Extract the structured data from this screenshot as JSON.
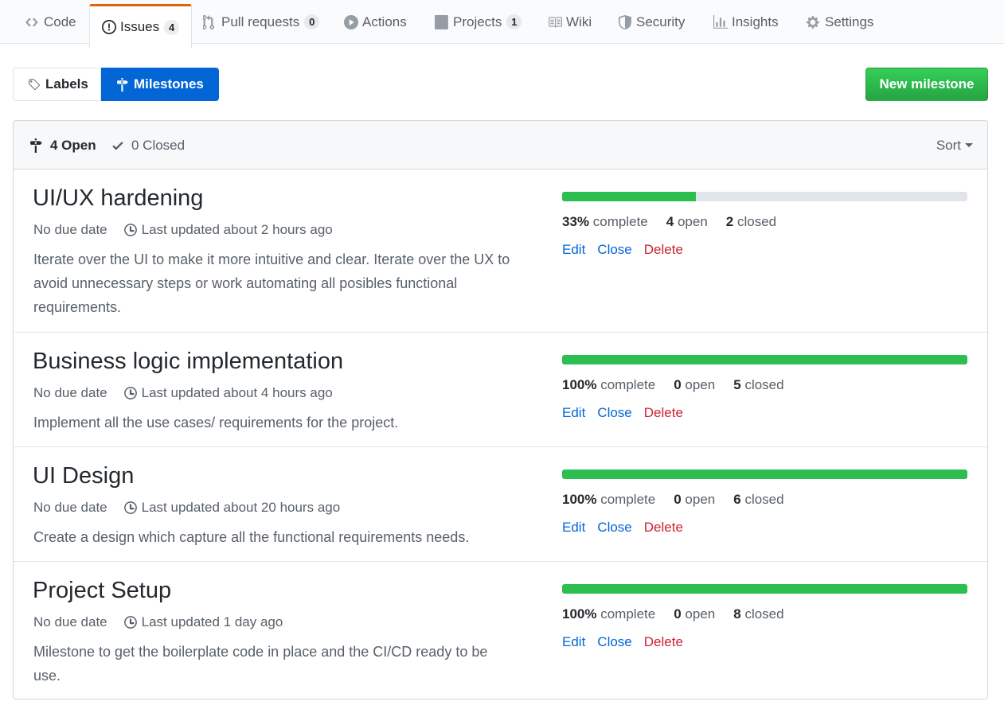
{
  "nav": {
    "tabs": [
      {
        "label": "Code",
        "icon": "code-icon"
      },
      {
        "label": "Issues",
        "icon": "issue-opened-icon",
        "count": "4"
      },
      {
        "label": "Pull requests",
        "icon": "git-pull-request-icon",
        "count": "0"
      },
      {
        "label": "Actions",
        "icon": "play-icon"
      },
      {
        "label": "Projects",
        "icon": "project-icon",
        "count": "1"
      },
      {
        "label": "Wiki",
        "icon": "book-icon"
      },
      {
        "label": "Security",
        "icon": "shield-icon"
      },
      {
        "label": "Insights",
        "icon": "graph-icon"
      },
      {
        "label": "Settings",
        "icon": "gear-icon"
      }
    ],
    "selected": "Issues"
  },
  "subnav": {
    "labels": "Labels",
    "milestones": "Milestones",
    "new_button": "New milestone"
  },
  "header": {
    "open": "4 Open",
    "closed": "0 Closed",
    "sort": "Sort"
  },
  "colors": {
    "progress": "#2cbe4e",
    "primary": "#28a745",
    "selected": "#0366d6",
    "danger": "#cb2431",
    "tab_accent": "#e36209"
  },
  "milestones": [
    {
      "title": "UI/UX hardening",
      "due": "No due date",
      "updated": "Last updated about 2 hours ago",
      "description": "Iterate over the UI to make it more intuitive and clear. Iterate over the UX to avoid unnecessary steps or work automating all posibles functional requirements.",
      "percent_value": 0.33,
      "percent": "33%",
      "complete": "complete",
      "open_count": "4",
      "open_label": "open",
      "closed_count": "2",
      "closed_label": "closed",
      "edit": "Edit",
      "close": "Close",
      "delete": "Delete"
    },
    {
      "title": "Business logic implementation",
      "due": "No due date",
      "updated": "Last updated about 4 hours ago",
      "description": "Implement all the use cases/ requirements for the project.",
      "percent_value": 1,
      "percent": "100%",
      "complete": "complete",
      "open_count": "0",
      "open_label": "open",
      "closed_count": "5",
      "closed_label": "closed",
      "edit": "Edit",
      "close": "Close",
      "delete": "Delete"
    },
    {
      "title": "UI Design",
      "due": "No due date",
      "updated": "Last updated about 20 hours ago",
      "description": "Create a design which capture all the functional requirements needs.",
      "percent_value": 1,
      "percent": "100%",
      "complete": "complete",
      "open_count": "0",
      "open_label": "open",
      "closed_count": "6",
      "closed_label": "closed",
      "edit": "Edit",
      "close": "Close",
      "delete": "Delete"
    },
    {
      "title": "Project Setup",
      "due": "No due date",
      "updated": "Last updated 1 day ago",
      "description": "Milestone to get the boilerplate code in place and the CI/CD ready to be use.",
      "percent_value": 1,
      "percent": "100%",
      "complete": "complete",
      "open_count": "0",
      "open_label": "open",
      "closed_count": "8",
      "closed_label": "closed",
      "edit": "Edit",
      "close": "Close",
      "delete": "Delete"
    }
  ]
}
